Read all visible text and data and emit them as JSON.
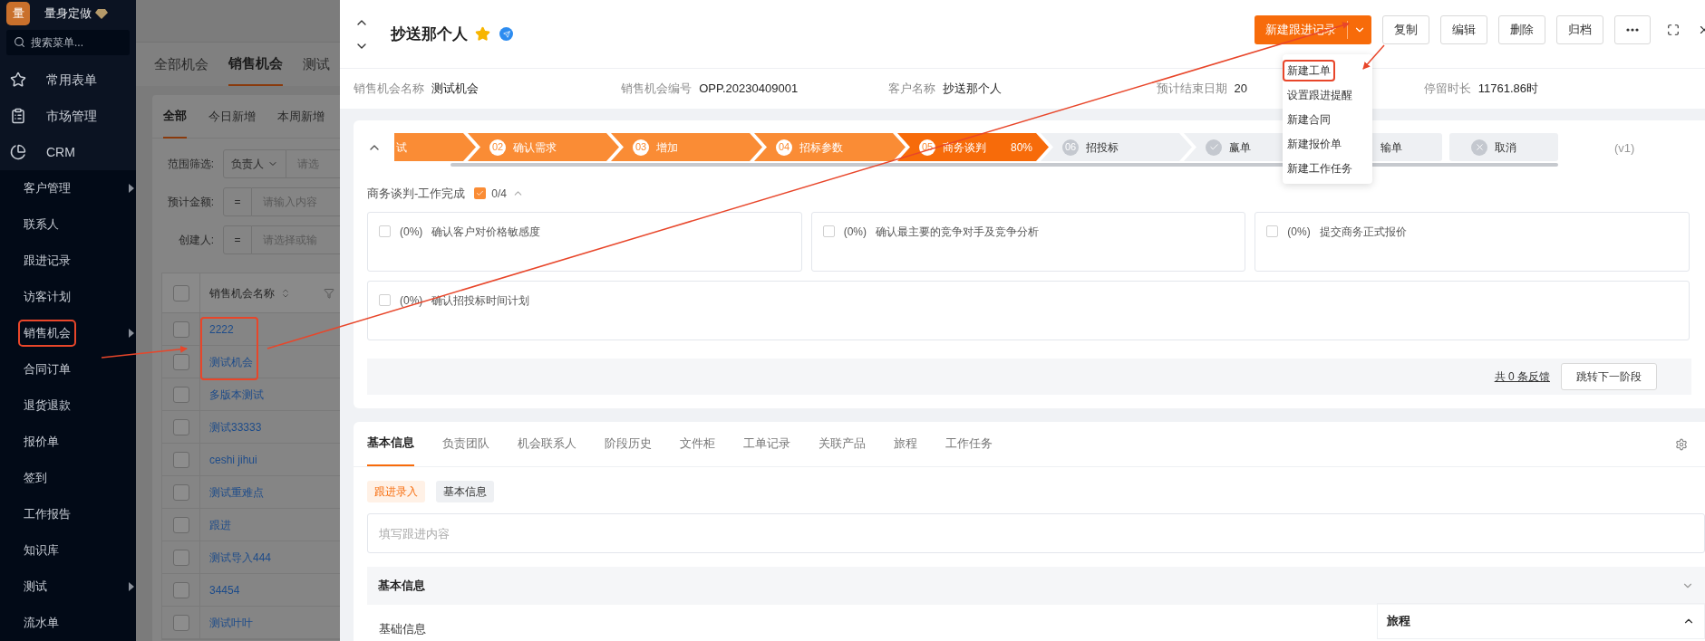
{
  "sidebar": {
    "logo_text": "量",
    "brand": "量身定做",
    "search": {
      "placeholder": "搜索菜单..."
    },
    "items": [
      {
        "label": "常用表单"
      },
      {
        "label": "市场管理"
      },
      {
        "label": "CRM",
        "children": [
          {
            "label": "客户管理",
            "has_submenu": true,
            "highlighted": false
          },
          {
            "label": "联系人",
            "has_submenu": false,
            "highlighted": false
          },
          {
            "label": "跟进记录",
            "has_submenu": false,
            "highlighted": false
          },
          {
            "label": "访客计划",
            "has_submenu": false,
            "highlighted": false
          },
          {
            "label": "销售机会",
            "has_submenu": true,
            "highlighted": true
          },
          {
            "label": "合同订单",
            "has_submenu": false,
            "highlighted": false
          },
          {
            "label": "退货退款",
            "has_submenu": false,
            "highlighted": false
          },
          {
            "label": "报价单",
            "has_submenu": false,
            "highlighted": false
          },
          {
            "label": "签到",
            "has_submenu": false,
            "highlighted": false
          },
          {
            "label": "工作报告",
            "has_submenu": false,
            "highlighted": false
          },
          {
            "label": "知识库",
            "has_submenu": false,
            "highlighted": false
          },
          {
            "label": "测试",
            "has_submenu": true,
            "highlighted": false
          },
          {
            "label": "流水单",
            "has_submenu": false,
            "highlighted": false
          }
        ]
      }
    ]
  },
  "list_panel": {
    "tabs": [
      {
        "label": "全部机会",
        "selected": false
      },
      {
        "label": "销售机会",
        "selected": true
      },
      {
        "label": "测试",
        "selected": false
      }
    ],
    "subtabs": [
      {
        "label": "全部",
        "selected": true
      },
      {
        "label": "今日新增",
        "selected": false
      },
      {
        "label": "本周新增",
        "selected": false
      }
    ],
    "filters": [
      {
        "label": "范围筛选:",
        "operator": "负责人",
        "placeholder": "请选"
      },
      {
        "label": "预计金额:",
        "operator": "=",
        "placeholder": "请输入内容"
      },
      {
        "label": "创建人:",
        "operator": "=",
        "placeholder": "请选择或输"
      }
    ],
    "table": {
      "column": "销售机会名称",
      "all_checked": false,
      "rows": [
        {
          "name": "2222",
          "highlighted": true,
          "checked": false
        },
        {
          "name": "测试机会",
          "highlighted": true,
          "checked": false
        },
        {
          "name": "多版本测试",
          "highlighted": false,
          "checked": false
        },
        {
          "name": "测试33333",
          "highlighted": false,
          "checked": false
        },
        {
          "name": "ceshi jihui",
          "highlighted": false,
          "checked": false
        },
        {
          "name": "测试重难点",
          "highlighted": false,
          "checked": false
        },
        {
          "name": "跟进",
          "highlighted": false,
          "checked": false
        },
        {
          "name": "测试导入444",
          "highlighted": false,
          "checked": false
        },
        {
          "name": "34454",
          "highlighted": false,
          "checked": false
        },
        {
          "name": "测试叶叶",
          "highlighted": false,
          "checked": false
        }
      ]
    }
  },
  "drawer": {
    "title": "抄送那个人",
    "starred": true,
    "primary_button": "新建跟进记录",
    "buttons": [
      "复制",
      "编辑",
      "删除",
      "归档"
    ],
    "dropdown": [
      {
        "label": "新建工单",
        "highlighted": true
      },
      {
        "label": "设置跟进提醒",
        "highlighted": false
      },
      {
        "label": "新建合同",
        "highlighted": false
      },
      {
        "label": "新建报价单",
        "highlighted": false
      },
      {
        "label": "新建工作任务",
        "highlighted": false
      }
    ],
    "fields": [
      {
        "label": "销售机会名称",
        "value": "测试机会"
      },
      {
        "label": "销售机会编号",
        "value": "OPP.20230409001"
      },
      {
        "label": "客户名称",
        "value": "抄送那个人"
      },
      {
        "label": "预计结束日期",
        "value": "20"
      },
      {
        "label": "停留时长",
        "value": "11761.86时"
      }
    ],
    "stages": [
      {
        "kind": "done",
        "label": "试"
      },
      {
        "kind": "done",
        "number": "02",
        "label": "确认需求"
      },
      {
        "kind": "done",
        "number": "03",
        "label": "增加"
      },
      {
        "kind": "done",
        "number": "04",
        "label": "招标参数"
      },
      {
        "kind": "current",
        "number": "05",
        "label": "商务谈判",
        "percent": "80%"
      },
      {
        "kind": "pending",
        "number": "06",
        "label": "招投标"
      },
      {
        "kind": "won",
        "label": "赢单"
      },
      {
        "kind": "lost",
        "label": "输单"
      },
      {
        "kind": "cancel",
        "label": "取消"
      }
    ],
    "version": "(v1)",
    "tasks_title": "商务谈判-工作完成",
    "tasks_count": "0/4",
    "tasks": [
      {
        "percent": "(0%)",
        "label": "确认客户对价格敏感度",
        "checked": false
      },
      {
        "percent": "(0%)",
        "label": "确认最主要的竞争对手及竞争分析",
        "checked": false
      },
      {
        "percent": "(0%)",
        "label": "提交商务正式报价",
        "checked": false
      },
      {
        "percent": "(0%)",
        "label": "确认招投标时间计划",
        "checked": false
      }
    ],
    "feedback_link": "共 0 条反馈",
    "next_stage_button": "跳转下一阶段",
    "tabs": [
      {
        "label": "基本信息",
        "selected": true
      },
      {
        "label": "负责团队",
        "selected": false
      },
      {
        "label": "机会联系人",
        "selected": false
      },
      {
        "label": "阶段历史",
        "selected": false
      },
      {
        "label": "文件柜",
        "selected": false
      },
      {
        "label": "工单记录",
        "selected": false
      },
      {
        "label": "关联产品",
        "selected": false
      },
      {
        "label": "旅程",
        "selected": false
      },
      {
        "label": "工作任务",
        "selected": false
      }
    ],
    "entry_tags": [
      {
        "label": "跟进录入",
        "selected": true
      },
      {
        "label": "基本信息",
        "selected": false
      }
    ],
    "entry_placeholder": "填写跟进内容",
    "section_title": "基本信息",
    "subsection_title": "基础信息",
    "journey_panel": {
      "title": "旅程",
      "expanded": true
    }
  }
}
